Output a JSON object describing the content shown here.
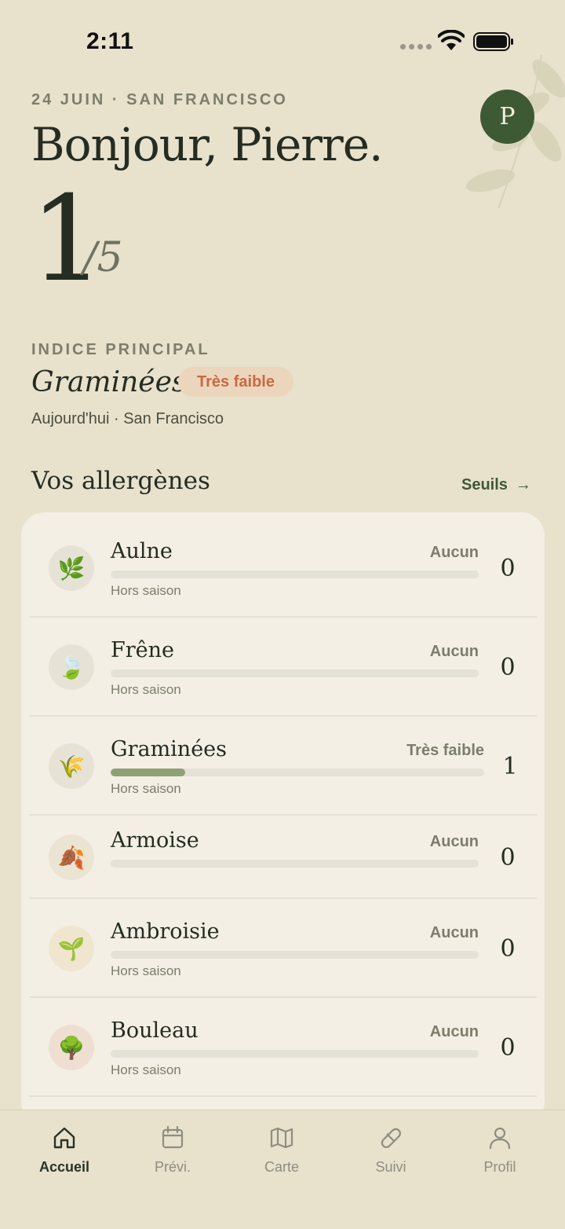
{
  "status": {
    "time": "2:11"
  },
  "header": {
    "date_location": "24 JUIN · SAN FRANCISCO",
    "greeting": "Bonjour, Pierre.",
    "avatar_initial": "P"
  },
  "index": {
    "value": "1",
    "max": "/5",
    "label": "INDICE PRINCIPAL",
    "allergen": "Graminées",
    "level": "Très faible",
    "subtitle": "Aujourd'hui · San Francisco"
  },
  "section": {
    "title": "Vos allergènes",
    "link_label": "Seuils",
    "link_arrow": "→"
  },
  "allergens": [
    {
      "name": "Aulne",
      "level": "Aucun",
      "status": "Hors saison",
      "value": "0",
      "fill": 0,
      "icon": "🌿",
      "icon_name": "herb-icon",
      "icon_bg": "#e6e3d6"
    },
    {
      "name": "Frêne",
      "level": "Aucun",
      "status": "Hors saison",
      "value": "0",
      "fill": 0,
      "icon": "🍃",
      "icon_name": "leaf-icon",
      "icon_bg": "#e6e3d6"
    },
    {
      "name": "Graminées",
      "level": "Très faible",
      "status": "Hors saison",
      "value": "1",
      "fill": 0.2,
      "icon": "🌾",
      "icon_name": "grain-icon",
      "icon_bg": "#e6e3d6"
    },
    {
      "name": "Armoise",
      "level": "Aucun",
      "status": "",
      "value": "0",
      "fill": 0,
      "icon": "🍂",
      "icon_name": "fallen-leaf-icon",
      "icon_bg": "#ebe4d3"
    },
    {
      "name": "Ambroisie",
      "level": "Aucun",
      "status": "Hors saison",
      "value": "0",
      "fill": 0,
      "icon": "🌱",
      "icon_name": "seedling-icon",
      "icon_bg": "#f0e6cf"
    },
    {
      "name": "Bouleau",
      "level": "Aucun",
      "status": "Hors saison",
      "value": "0",
      "fill": 0,
      "icon": "🌳",
      "icon_name": "tree-icon",
      "icon_bg": "#efdfd2"
    }
  ],
  "nav": [
    {
      "label": "Accueil",
      "icon": "home-icon",
      "active": true
    },
    {
      "label": "Prévi.",
      "icon": "calendar-icon",
      "active": false
    },
    {
      "label": "Carte",
      "icon": "map-icon",
      "active": false
    },
    {
      "label": "Suivi",
      "icon": "pill-icon",
      "active": false
    },
    {
      "label": "Profil",
      "icon": "person-icon",
      "active": false
    }
  ],
  "colors": {
    "background": "#e8e1cc",
    "card": "#f3efe5",
    "accent_green": "#3d5a35",
    "bar_fill": "#8ea174",
    "badge_bg": "#ecd5bd",
    "badge_text": "#c66a44"
  }
}
